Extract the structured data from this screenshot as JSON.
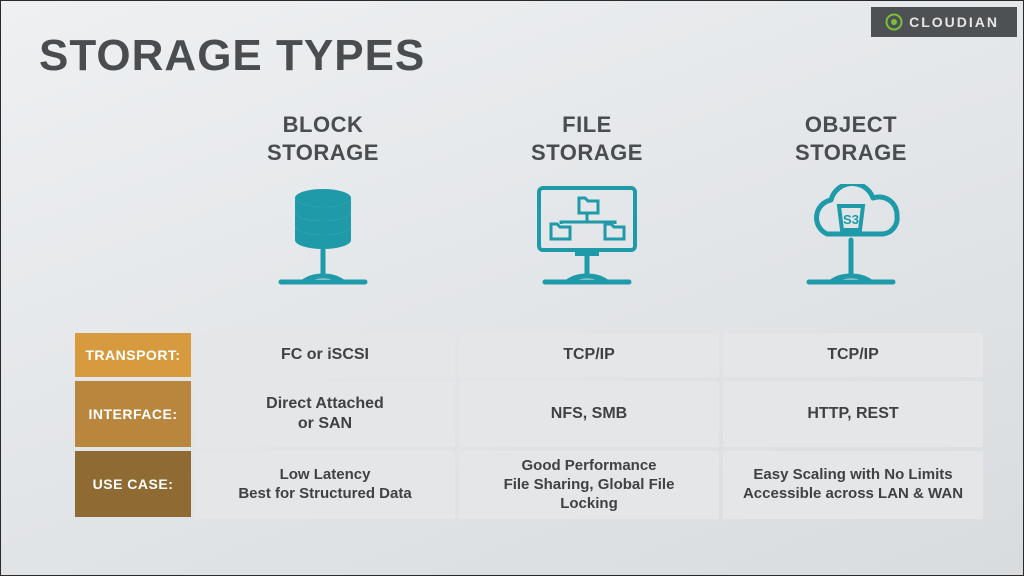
{
  "brand": "CLOUDIAN",
  "title": "STORAGE TYPES",
  "columns": [
    {
      "name_l1": "BLOCK",
      "name_l2": "STORAGE"
    },
    {
      "name_l1": "FILE",
      "name_l2": "STORAGE"
    },
    {
      "name_l1": "OBJECT",
      "name_l2": "STORAGE"
    }
  ],
  "object_badge": "S3",
  "rows": {
    "transport": {
      "label": "TRANSPORT:",
      "cells": [
        "FC or iSCSI",
        "TCP/IP",
        "TCP/IP"
      ]
    },
    "interface": {
      "label": "INTERFACE:",
      "cells": [
        "Direct Attached\nor SAN",
        "NFS, SMB",
        "HTTP, REST"
      ]
    },
    "usecase": {
      "label": "USE CASE:",
      "cells": [
        "Low Latency\nBest for Structured Data",
        "Good Performance\nFile Sharing, Global File Locking",
        "Easy Scaling with No Limits\nAccessible across LAN & WAN"
      ]
    }
  }
}
